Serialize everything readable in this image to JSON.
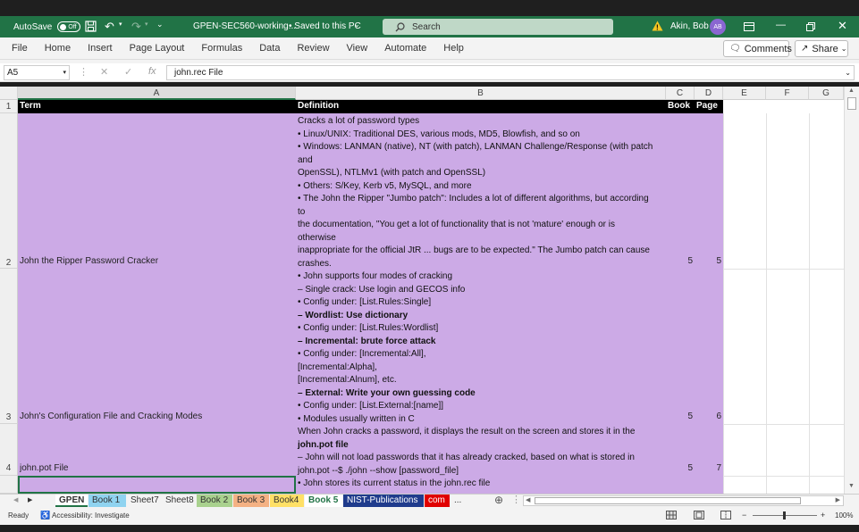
{
  "titlebar": {
    "autosave_label": "AutoSave",
    "autosave_state": "Off",
    "filename": "GPEN-SEC560-working...",
    "saved_status": "• Saved to this PC",
    "search_placeholder": "Search",
    "user_name": "Akin, Bob",
    "user_initials": "AB"
  },
  "menu": {
    "items": [
      "File",
      "Home",
      "Insert",
      "Page Layout",
      "Formulas",
      "Data",
      "Review",
      "View",
      "Automate",
      "Help"
    ],
    "comments_label": "Comments",
    "share_label": "Share"
  },
  "formula_bar": {
    "name_box": "A5",
    "fx": "fx",
    "content": "john.rec File"
  },
  "columns": [
    "A",
    "B",
    "C",
    "D",
    "E",
    "F",
    "G"
  ],
  "rows": [
    "1",
    "2",
    "3",
    "4"
  ],
  "table": {
    "headers": [
      "Term",
      "Definition",
      "Book",
      "Page"
    ],
    "terms": [
      "John the Ripper Password Cracker",
      "John's Configuration File and Cracking Modes",
      "john.pot File"
    ],
    "books": [
      "5",
      "5",
      "5"
    ],
    "pages": [
      "5",
      "6",
      "7"
    ],
    "definition_lines": [
      {
        "text": "Cracks a lot of password types",
        "bold": false
      },
      {
        "text": "• Linux/UNIX: Traditional DES, various mods, MD5, Blowfish, and so on",
        "bold": false
      },
      {
        "text": "• Windows: LANMAN (native), NT (with patch), LANMAN Challenge/Response (with patch",
        "bold": false
      },
      {
        "text": "and",
        "bold": false
      },
      {
        "text": "OpenSSL), NTLMv1 (with patch and OpenSSL)",
        "bold": false
      },
      {
        "text": "• Others: S/Key, Kerb v5, MySQL, and more",
        "bold": false
      },
      {
        "text": "• The John the Ripper \"Jumbo patch\": Includes a lot of different algorithms, but according",
        "bold": false
      },
      {
        "text": "to",
        "bold": false
      },
      {
        "text": "the documentation, \"You get a lot of functionality that is not 'mature' enough or is",
        "bold": false
      },
      {
        "text": "otherwise",
        "bold": false
      },
      {
        "text": "inappropriate for the official JtR ... bugs are to be expected.\" The Jumbo patch can cause",
        "bold": false
      },
      {
        "text": "crashes.",
        "bold": false
      },
      {
        "text": "• John supports four modes of cracking",
        "bold": false
      },
      {
        "text": "– Single crack: Use login and GECOS info",
        "bold": false
      },
      {
        "text": "• Config under: [List.Rules:Single]",
        "bold": false
      },
      {
        "text": "– Wordlist: Use dictionary",
        "bold": true
      },
      {
        "text": "• Config under: [List.Rules:Wordlist]",
        "bold": false
      },
      {
        "text": "– Incremental: brute force attack",
        "bold": true
      },
      {
        "text": "• Config under: [Incremental:All],",
        "bold": false
      },
      {
        "text": "[Incremental:Alpha],",
        "bold": false
      },
      {
        "text": "[Incremental:Alnum], etc.",
        "bold": false
      },
      {
        "text": "– External: Write your own guessing code",
        "bold": true
      },
      {
        "text": "• Config under: [List.External:[name]]",
        "bold": false
      },
      {
        "text": "• Modules usually written in C",
        "bold": false
      },
      {
        "text": "When John cracks a password, it displays the result on the screen and stores it in the",
        "bold": false
      },
      {
        "text": "john.pot file",
        "bold": true
      },
      {
        "text": "– John will not load passwords that it has already cracked, based on what is stored in",
        "bold": false
      },
      {
        "text": "john.pot --$ ./john --show [password_file]",
        "bold": false
      },
      {
        "text": "• John stores its current status in the john.rec file",
        "bold": false
      }
    ]
  },
  "sheet_tabs": [
    {
      "label": "GPEN",
      "color": "#ffffff"
    },
    {
      "label": "Book 1",
      "color": "#8fd3f0"
    },
    {
      "label": "Sheet7",
      "color": "#f3f3f3"
    },
    {
      "label": "Sheet8",
      "color": "#f3f3f3"
    },
    {
      "label": "Book 2",
      "color": "#a9d18e"
    },
    {
      "label": "Book 3",
      "color": "#f4b183"
    },
    {
      "label": "Book4",
      "color": "#ffe066"
    },
    {
      "label": "Book 5",
      "color": "#ffffff"
    },
    {
      "label": "NIST-Publications",
      "color": "#1f3b8c"
    },
    {
      "label": "com",
      "color": "#e00000"
    },
    {
      "label": "...",
      "color": "#f3f3f3"
    }
  ],
  "status": {
    "ready": "Ready",
    "accessibility": "Accessibility: Investigate",
    "zoom": "100%"
  },
  "colors": {
    "excel_green": "#217346",
    "cell_purple": "#ccaae6",
    "header_black": "#000000"
  }
}
